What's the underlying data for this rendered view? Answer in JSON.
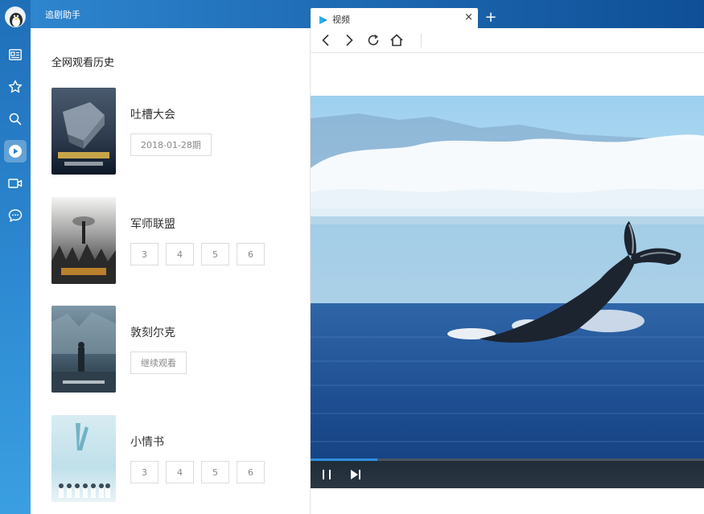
{
  "app": {
    "title": "追剧助手"
  },
  "sidebar": {
    "items": [
      {
        "name": "news",
        "icon": "news-icon"
      },
      {
        "name": "favorites",
        "icon": "star-icon"
      },
      {
        "name": "search",
        "icon": "search-icon"
      },
      {
        "name": "player",
        "icon": "play-icon",
        "active": true
      },
      {
        "name": "camera",
        "icon": "video-camera-icon"
      },
      {
        "name": "chat",
        "icon": "chat-bubble-icon"
      }
    ]
  },
  "history": {
    "title": "全网观看历史",
    "items": [
      {
        "title": "吐槽大会",
        "episodes": [
          "2018-01-28期"
        ]
      },
      {
        "title": "军师联盟",
        "episodes": [
          "3",
          "4",
          "5",
          "6"
        ]
      },
      {
        "title": "敦刻尔克",
        "episodes": [
          "继续观看"
        ]
      },
      {
        "title": "小情书",
        "episodes": [
          "3",
          "4",
          "5",
          "6"
        ]
      }
    ]
  },
  "browser": {
    "tab": {
      "label": "视频",
      "close": "×"
    },
    "new_tab": "+",
    "nav": [
      "back-icon",
      "forward-icon",
      "refresh-icon",
      "home-icon"
    ],
    "player": {
      "progress": 0.17
    }
  },
  "colors": {
    "accent": "#2f8fe0",
    "rail_top": "#1f6fb8",
    "topbar_dark": "#0f4f97"
  }
}
